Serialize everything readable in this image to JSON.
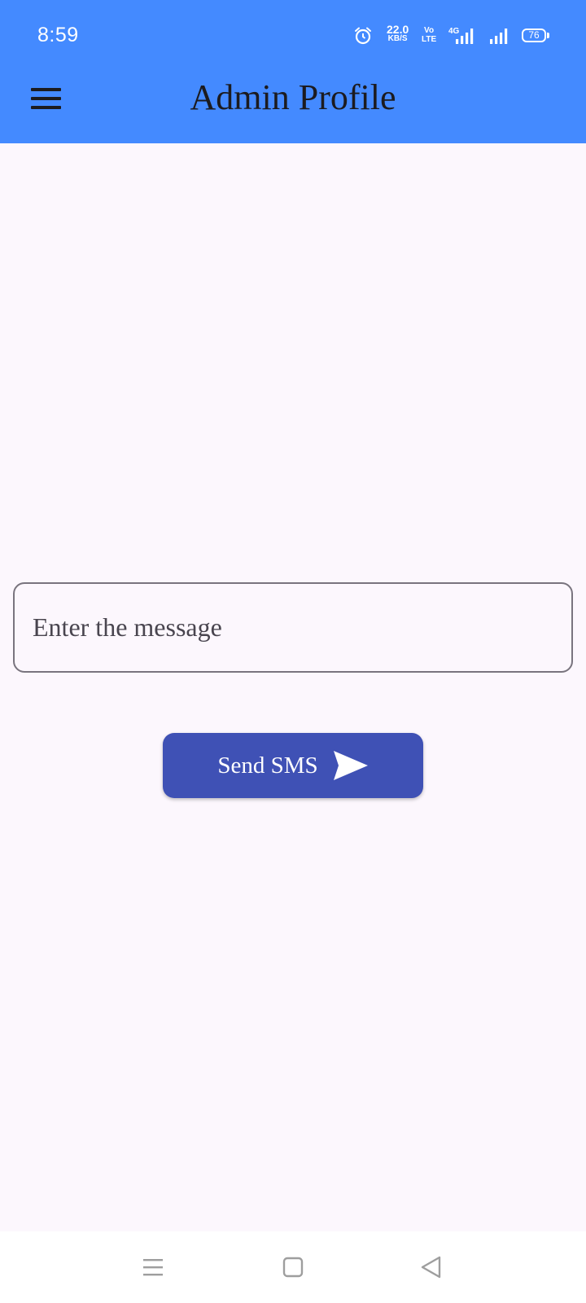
{
  "status_bar": {
    "time": "8:59",
    "net_speed_value": "22.0",
    "net_speed_unit": "KB/S",
    "volte_top": "Vo",
    "volte_bottom": "LTE",
    "network_type": "4G",
    "battery_level": "76",
    "icons": [
      "alarm-icon",
      "signal-icon",
      "battery-icon"
    ]
  },
  "appbar": {
    "title": "Admin Profile",
    "menu_icon": "hamburger-menu-icon",
    "background_color": "#448aff"
  },
  "message_input": {
    "placeholder": "Enter the message",
    "value": ""
  },
  "send_button": {
    "label": "Send SMS",
    "icon": "send-icon",
    "color": "#3f51b5"
  },
  "nav_bar": {
    "items": [
      "recents-icon",
      "home-icon",
      "back-icon"
    ]
  }
}
